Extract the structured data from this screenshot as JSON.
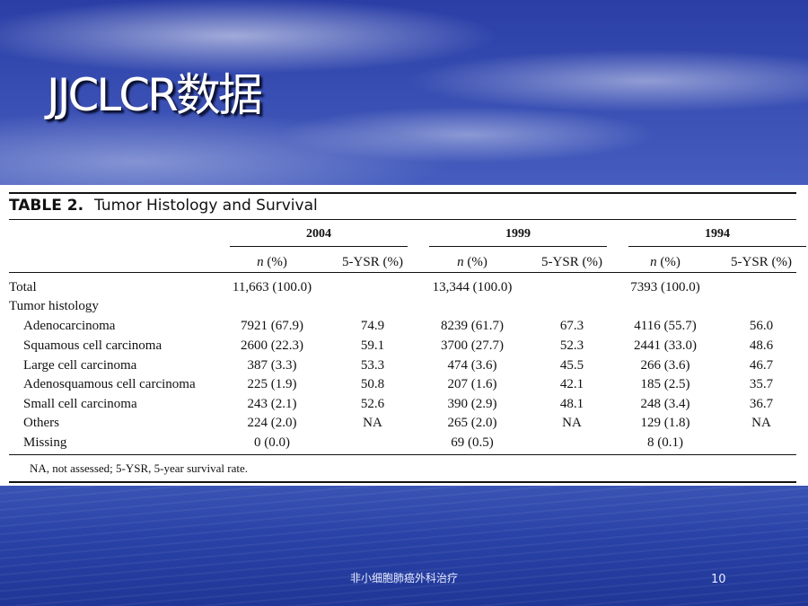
{
  "slide": {
    "title": "JJCLCR数据",
    "footer_text": "非小细胞肺癌外科治疗",
    "page_number": "10"
  },
  "table": {
    "label": "TABLE 2.",
    "caption": "Tumor Histology and Survival",
    "years": [
      "2004",
      "1999",
      "1994"
    ],
    "col_n": "(%)",
    "col_n_prefix": "n",
    "col_ysr": "5-YSR (%)",
    "rows": [
      {
        "label": "Total",
        "indent": false,
        "cells": [
          "11,663 (100.0)",
          "",
          "13,344 (100.0)",
          "",
          "7393 (100.0)",
          ""
        ]
      },
      {
        "label": "Tumor histology",
        "indent": false,
        "cells": [
          "",
          "",
          "",
          "",
          "",
          ""
        ]
      },
      {
        "label": "Adenocarcinoma",
        "indent": true,
        "cells": [
          "7921 (67.9)",
          "74.9",
          "8239 (61.7)",
          "67.3",
          "4116 (55.7)",
          "56.0"
        ]
      },
      {
        "label": "Squamous cell carcinoma",
        "indent": true,
        "cells": [
          "2600 (22.3)",
          "59.1",
          "3700 (27.7)",
          "52.3",
          "2441 (33.0)",
          "48.6"
        ]
      },
      {
        "label": "Large cell carcinoma",
        "indent": true,
        "cells": [
          "387 (3.3)",
          "53.3",
          "474 (3.6)",
          "45.5",
          "266 (3.6)",
          "46.7"
        ]
      },
      {
        "label": "Adenosquamous cell carcinoma",
        "indent": true,
        "cells": [
          "225 (1.9)",
          "50.8",
          "207 (1.6)",
          "42.1",
          "185 (2.5)",
          "35.7"
        ]
      },
      {
        "label": "Small cell carcinoma",
        "indent": true,
        "cells": [
          "243 (2.1)",
          "52.6",
          "390 (2.9)",
          "48.1",
          "248 (3.4)",
          "36.7"
        ]
      },
      {
        "label": "Others",
        "indent": true,
        "cells": [
          "224 (2.0)",
          "NA",
          "265 (2.0)",
          "NA",
          "129 (1.8)",
          "NA"
        ]
      },
      {
        "label": "Missing",
        "indent": true,
        "cells": [
          "0 (0.0)",
          "",
          "69 (0.5)",
          "",
          "8 (0.1)",
          ""
        ]
      }
    ],
    "footnote": "NA, not assessed; 5-YSR, 5-year survival rate."
  }
}
